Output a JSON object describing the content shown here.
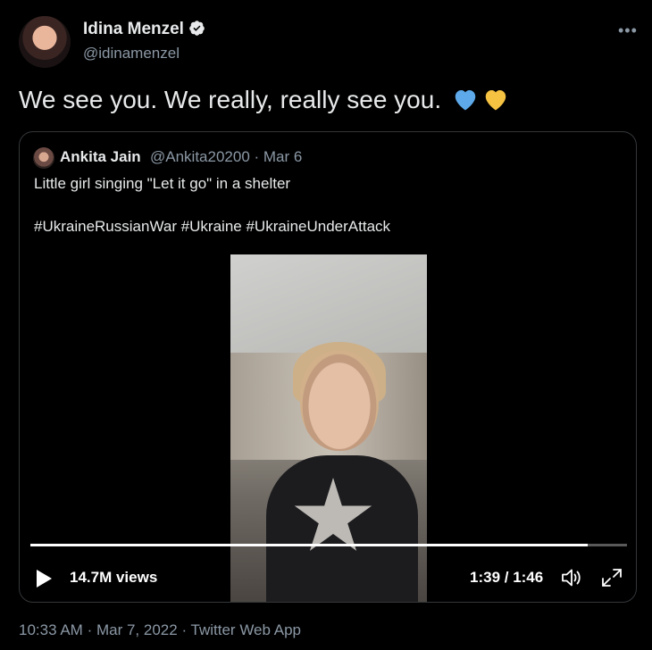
{
  "tweet": {
    "author_name": "Idina Menzel",
    "author_handle": "@idinamenzel",
    "text": "We see you. We really, really see you.",
    "emoji_icons": [
      "blue-heart-icon",
      "yellow-heart-icon"
    ],
    "timestamp": "10:33 AM",
    "date": "Mar 7, 2022",
    "source": "Twitter Web App",
    "meta_separator": "·"
  },
  "quoted": {
    "author_name": "Ankita Jain",
    "author_handle": "@Ankita20200 · Mar 6",
    "text_line1": "Little girl singing \"Let it go\" in a shelter",
    "text_line2": "#UkraineRussianWar #Ukraine #UkraineUnderAttack"
  },
  "video": {
    "views": "14.7M views",
    "time": "1:39 / 1:46",
    "progress": 0.934
  },
  "colors": {
    "background": "#000000",
    "text": "#e7e9ea",
    "secondary": "#8b98a5",
    "blue_heart": "#5da9e9",
    "yellow_heart": "#f5c242"
  }
}
